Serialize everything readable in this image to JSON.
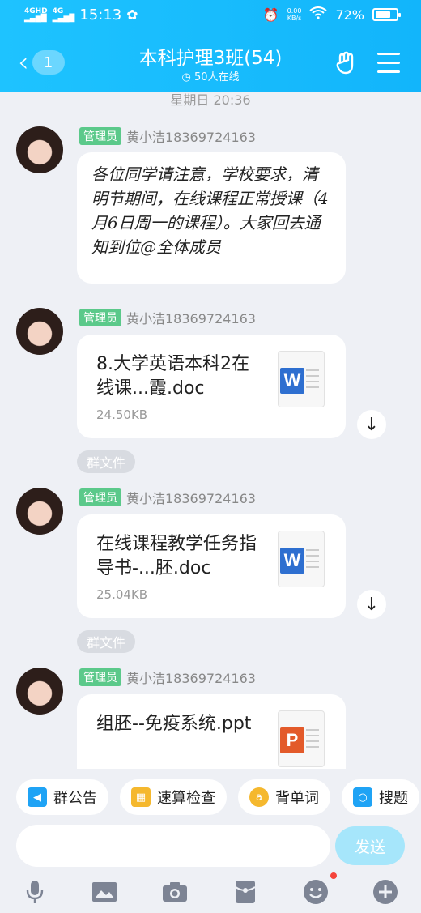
{
  "status_bar": {
    "network_1": "4GHD",
    "network_2": "4G",
    "time": "15:13",
    "speed_value": "0.00",
    "speed_unit": "KB/s",
    "battery": "72%"
  },
  "header": {
    "unread_count": "1",
    "title": "本科护理3班(54)",
    "online": "50人在线"
  },
  "timestamp": "星期日 20:36",
  "messages": [
    {
      "role": "管理员",
      "sender": "黄小洁18369724163",
      "text": "各位同学请注意，学校要求，清明节期间，在线课程正常授课（4月6日周一的课程）。大家回去通知到位@全体成员"
    },
    {
      "role": "管理员",
      "sender": "黄小洁18369724163",
      "file_name": "8.大学英语本科2在线课...霞.doc",
      "file_size": "24.50KB",
      "file_type": "W",
      "tag": "群文件"
    },
    {
      "role": "管理员",
      "sender": "黄小洁18369724163",
      "file_name": "在线课程教学任务指导书-...胚.doc",
      "file_size": "25.04KB",
      "file_type": "W",
      "tag": "群文件"
    },
    {
      "role": "管理员",
      "sender": "黄小洁18369724163",
      "file_name": "组胚--免疫系统.ppt",
      "file_type": "P"
    }
  ],
  "tools": [
    "群公告",
    "速算检查",
    "背单词",
    "搜题"
  ],
  "input": {
    "placeholder": "",
    "send": "发送"
  },
  "colors": {
    "header": "#12b5fb",
    "word": "#2e6fd0",
    "ppt": "#e35a2a",
    "admin_badge": "#5bc98a"
  },
  "icons": [
    "mic-icon",
    "image-icon",
    "camera-icon",
    "redpacket-icon",
    "emoji-icon",
    "plus-icon"
  ]
}
